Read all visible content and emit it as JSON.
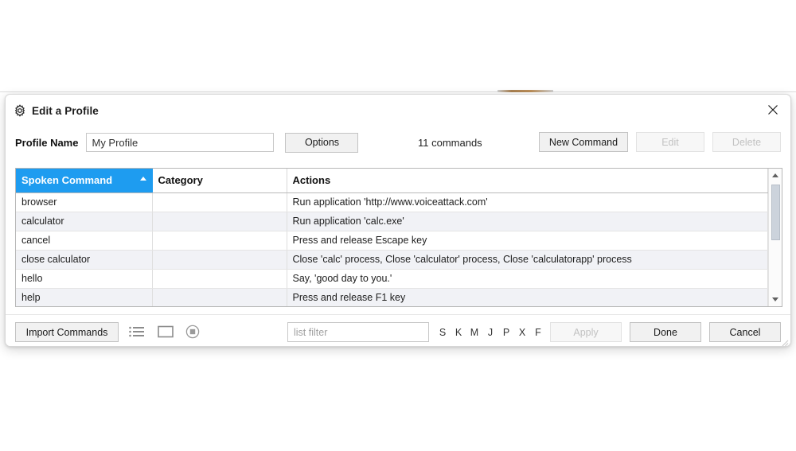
{
  "window": {
    "title": "Edit a Profile",
    "icon": "gear-icon",
    "close_label": "✕"
  },
  "toolbar": {
    "profile_name_label": "Profile Name",
    "profile_name_value": "My Profile",
    "profile_name_placeholder": "",
    "options_label": "Options",
    "command_count": "11 commands",
    "new_command_label": "New Command",
    "edit_label": "Edit",
    "delete_label": "Delete"
  },
  "grid": {
    "columns": [
      {
        "label": "Spoken Command",
        "sorted": true,
        "sort_dir": "asc"
      },
      {
        "label": "Category",
        "sorted": false,
        "sort_dir": ""
      },
      {
        "label": "Actions",
        "sorted": false,
        "sort_dir": ""
      }
    ],
    "rows": [
      {
        "spoken": "browser",
        "category": "",
        "actions": "Run application 'http://www.voiceattack.com'"
      },
      {
        "spoken": "calculator",
        "category": "",
        "actions": "Run application 'calc.exe'"
      },
      {
        "spoken": "cancel",
        "category": "",
        "actions": "Press and release Escape key"
      },
      {
        "spoken": "close calculator",
        "category": "",
        "actions": "Close 'calc' process, Close 'calculator' process, Close 'calculatorapp' process"
      },
      {
        "spoken": "hello",
        "category": "",
        "actions": "Say, 'good day to you.'"
      },
      {
        "spoken": "help",
        "category": "",
        "actions": "Press and release F1 key"
      }
    ]
  },
  "bottombar": {
    "import_label": "Import Commands",
    "list_view_icon": "list-view-icon",
    "window_view_icon": "window-view-icon",
    "record_icon": "record-stop-icon",
    "filter_placeholder": "list filter",
    "filter_value": "",
    "letters": [
      "S",
      "K",
      "M",
      "J",
      "P",
      "X",
      "F"
    ],
    "apply_label": "Apply",
    "done_label": "Done",
    "cancel_label": "Cancel"
  },
  "colors": {
    "sort_header_bg": "#1e9cf0",
    "row_alt_bg": "#f1f2f6",
    "scroll_thumb": "#ccd3dc"
  }
}
